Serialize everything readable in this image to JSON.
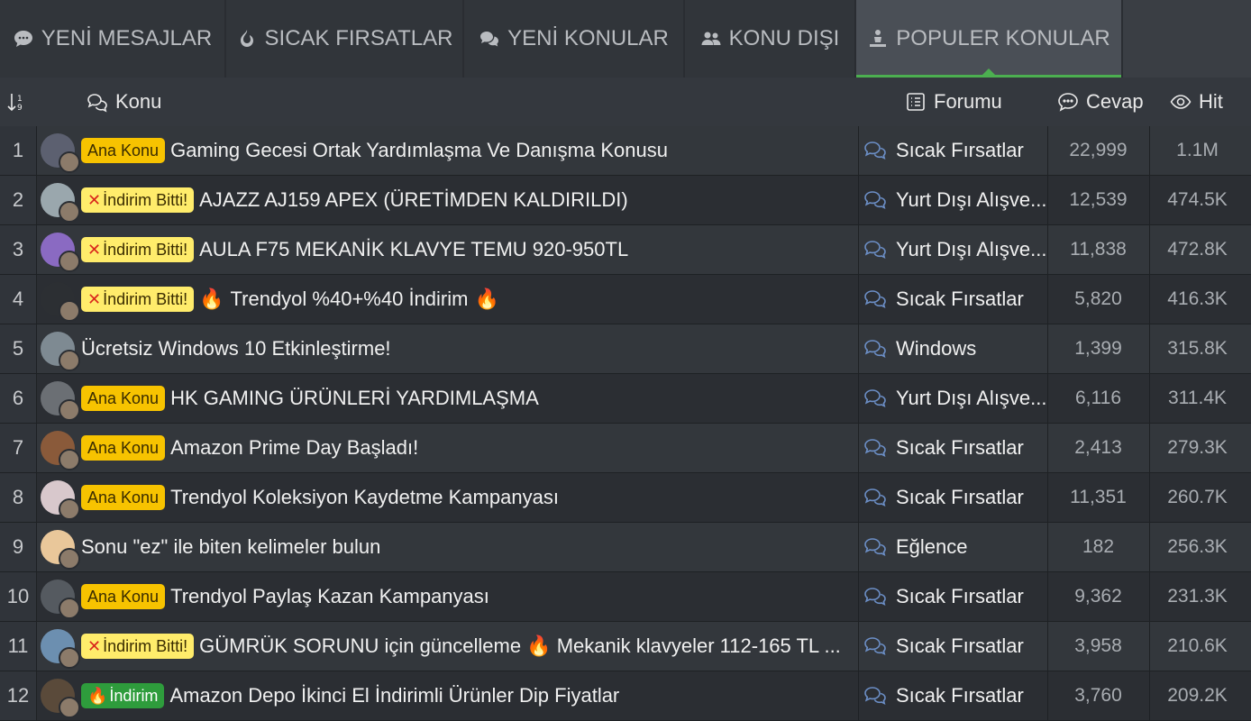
{
  "tabs": [
    {
      "label": "YENİ MESAJLAR",
      "icon": "chat-bubble-icon"
    },
    {
      "label": "SICAK FIRSATLAR",
      "icon": "flame-icon"
    },
    {
      "label": "YENİ KONULAR",
      "icon": "chat-bubbles-icon"
    },
    {
      "label": "KONU DIŞI",
      "icon": "users-icon"
    },
    {
      "label": "POPULER KONULAR",
      "icon": "person-podium-icon",
      "active": true
    }
  ],
  "header": {
    "sort_icon": "sort-icon",
    "topic": "Konu",
    "forum": "Forumu",
    "replies": "Cevap",
    "hits": "Hit"
  },
  "colors": {
    "accent": "#4caf50",
    "badge_ana": "#f7c300",
    "badge_bitti": "#ffec6b",
    "badge_indirim": "#2e9c3c"
  },
  "rows": [
    {
      "num": "1",
      "badge": "Ana Konu",
      "badge_type": "ana",
      "title": "Gaming Gecesi Ortak Yardımlaşma Ve Danışma Konusu",
      "forum": "Sıcak Fırsatlar",
      "replies": "22,999",
      "hits": "1.1M"
    },
    {
      "num": "2",
      "badge": "İndirim Bitti!",
      "badge_type": "bitti",
      "title": "AJAZZ AJ159 APEX (ÜRETİMDEN KALDIRILDI)",
      "forum": "Yurt Dışı Alışve...",
      "replies": "12,539",
      "hits": "474.5K"
    },
    {
      "num": "3",
      "badge": "İndirim Bitti!",
      "badge_type": "bitti",
      "title": "AULA F75 MEKANİK KLAVYE TEMU 920-950TL",
      "forum": "Yurt Dışı Alışve...",
      "replies": "11,838",
      "hits": "472.8K"
    },
    {
      "num": "4",
      "badge": "İndirim Bitti!",
      "badge_type": "bitti",
      "title_pre": "🔥",
      "title": "Trendyol %40+%40 İndirim",
      "title_post": "🔥",
      "forum": "Sıcak Fırsatlar",
      "replies": "5,820",
      "hits": "416.3K"
    },
    {
      "num": "5",
      "badge": "",
      "badge_type": "",
      "title": "Ücretsiz Windows 10 Etkinleştirme!",
      "forum": "Windows",
      "replies": "1,399",
      "hits": "315.8K"
    },
    {
      "num": "6",
      "badge": "Ana Konu",
      "badge_type": "ana",
      "title": "HK GAMING ÜRÜNLERİ YARDIMLAŞMA",
      "forum": "Yurt Dışı Alışve...",
      "replies": "6,116",
      "hits": "311.4K"
    },
    {
      "num": "7",
      "badge": "Ana Konu",
      "badge_type": "ana",
      "title": "Amazon Prime Day Başladı!",
      "forum": "Sıcak Fırsatlar",
      "replies": "2,413",
      "hits": "279.3K"
    },
    {
      "num": "8",
      "badge": "Ana Konu",
      "badge_type": "ana",
      "title": "Trendyol Koleksiyon Kaydetme Kampanyası",
      "forum": "Sıcak Fırsatlar",
      "replies": "11,351",
      "hits": "260.7K"
    },
    {
      "num": "9",
      "badge": "",
      "badge_type": "",
      "title": "Sonu \"ez\" ile biten kelimeler bulun",
      "forum": "Eğlence",
      "replies": "182",
      "hits": "256.3K"
    },
    {
      "num": "10",
      "badge": "Ana Konu",
      "badge_type": "ana",
      "title": "Trendyol Paylaş Kazan Kampanyası",
      "forum": "Sıcak Fırsatlar",
      "replies": "9,362",
      "hits": "231.3K"
    },
    {
      "num": "11",
      "badge": "İndirim Bitti!",
      "badge_type": "bitti",
      "title": "GÜMRÜK SORUNU için güncelleme 🔥 Mekanik klavyeler 112-165 TL ...",
      "forum": "Sıcak Fırsatlar",
      "replies": "3,958",
      "hits": "210.6K"
    },
    {
      "num": "12",
      "badge": "İndirim",
      "badge_type": "indirim",
      "title": "Amazon Depo İkinci El İndirimli Ürünler Dip Fiyatlar",
      "forum": "Sıcak Fırsatlar",
      "replies": "3,760",
      "hits": "209.2K"
    }
  ]
}
